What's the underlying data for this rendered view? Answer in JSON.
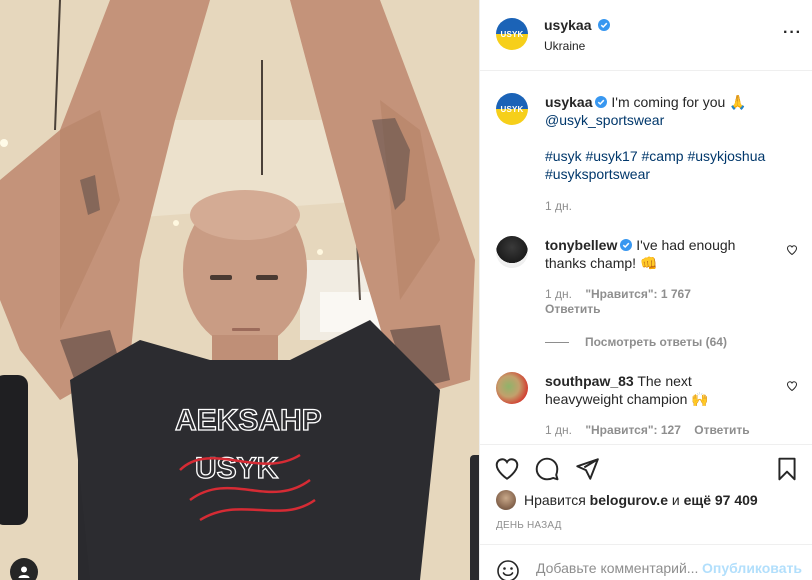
{
  "post": {
    "author": {
      "username": "usykaa",
      "location": "Ukraine",
      "avatar_label": "USYK"
    },
    "caption": {
      "text": "I'm coming for you 🙏",
      "mention": "@usyk_sportswear",
      "hashtags": [
        "#usyk",
        "#usyk17",
        "#camp",
        "#usykjoshua",
        "#usyksportswear"
      ],
      "time": "1 дн."
    },
    "comments": [
      {
        "username": "tonybellew",
        "verified": true,
        "text": "I've had enough thanks champ! 👊",
        "time": "1 дн.",
        "likes_label": "\"Нравится\": 1 767",
        "reply_label": "Ответить"
      },
      {
        "username": "southpaw_83",
        "verified": false,
        "text": "The next heavyweight champion 🙌",
        "time": "1 дн.",
        "likes_label": "\"Нравится\": 127",
        "reply_label": "Ответить"
      }
    ],
    "view_replies_label": "Посмотреть ответы (64)",
    "likes": {
      "prefix": "Нравится",
      "user": "belogurov.e",
      "connector": "и",
      "others": "ещё 97 409"
    },
    "timestamp": "ДЕНЬ НАЗАД",
    "add_comment": {
      "placeholder": "Добавьте комментарий...",
      "publish_label": "Опубликовать"
    }
  },
  "icons": {
    "verified": "verified-badge-icon",
    "like": "heart-icon",
    "comment": "comment-icon",
    "share": "send-icon",
    "save": "bookmark-icon",
    "emoji": "emoji-icon",
    "more": "more-options-icon",
    "tagged_user": "user-tag-icon"
  },
  "colors": {
    "link": "#00376b",
    "verified": "#3897f0",
    "muted": "#8e8e8e",
    "publish_disabled": "#b2dffc"
  }
}
